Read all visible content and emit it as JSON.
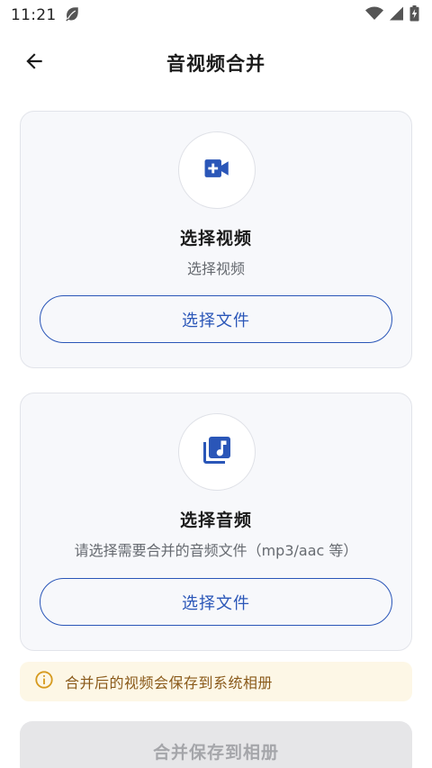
{
  "status_bar": {
    "time": "11:21"
  },
  "app_bar": {
    "title": "音视频合并"
  },
  "video_card": {
    "title": "选择视频",
    "subtitle": "选择视频",
    "button_label": "选择文件"
  },
  "audio_card": {
    "title": "选择音频",
    "subtitle": "请选择需要合并的音频文件（mp3/aac 等）",
    "button_label": "选择文件"
  },
  "info_banner": {
    "text": "合并后的视频会保存到系统相册"
  },
  "merge_button": {
    "label": "合并保存到相册",
    "enabled": false
  },
  "colors": {
    "accent": "#2a56b8",
    "card_bg": "#f7f8fb",
    "info_bg": "#fdf7e6",
    "info_text": "#8a5a1a",
    "disabled_bg": "#e6e6e8"
  }
}
